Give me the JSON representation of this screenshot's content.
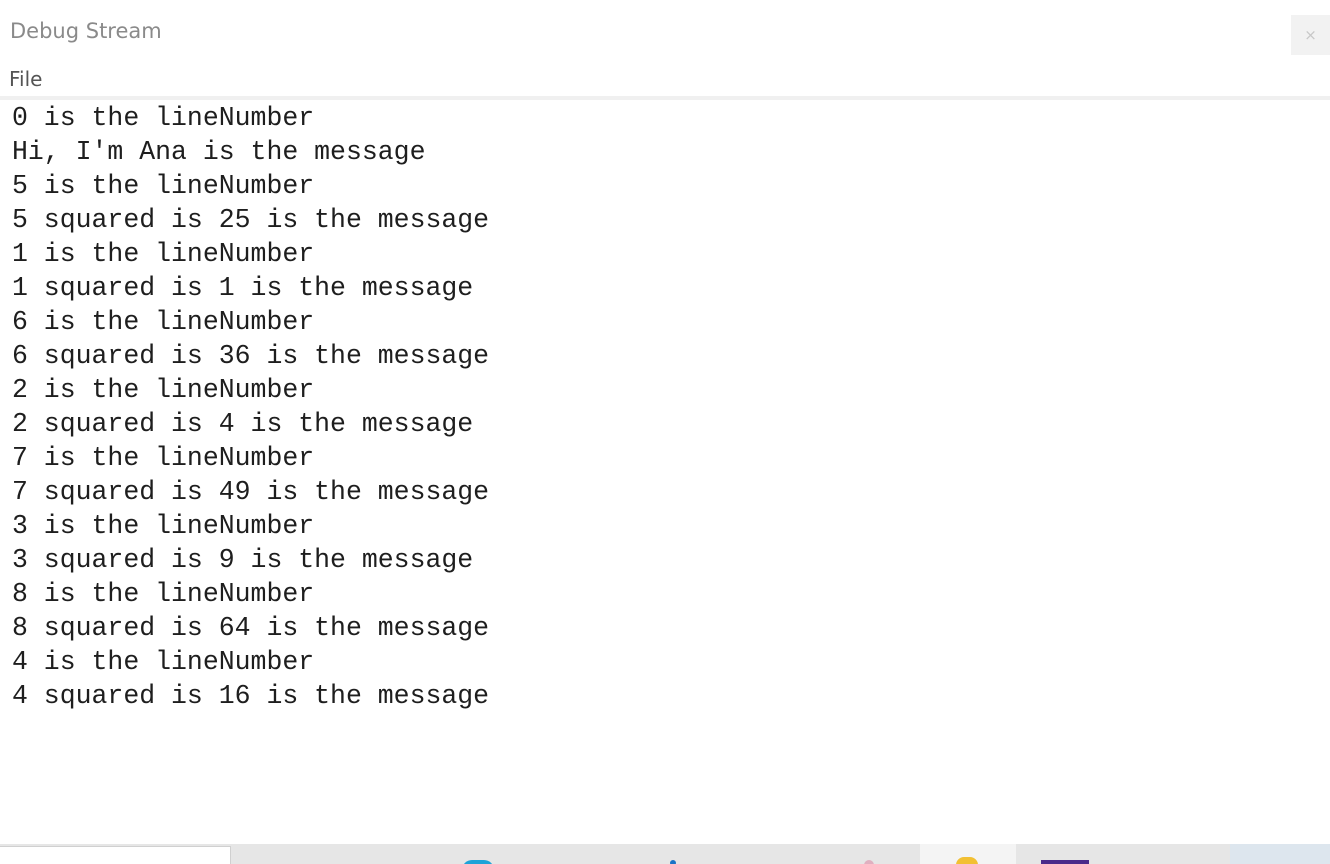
{
  "window": {
    "title": "Debug Stream",
    "close_glyph": "×"
  },
  "menu": {
    "items": [
      {
        "label": "File"
      }
    ]
  },
  "output": {
    "lines": [
      "0 is the lineNumber",
      "Hi, I'm Ana is the message",
      "5 is the lineNumber",
      "5 squared is 25 is the message",
      "1 is the lineNumber",
      "1 squared is 1 is the message",
      "6 is the lineNumber",
      "6 squared is 36 is the message",
      "2 is the lineNumber",
      "2 squared is 4 is the message",
      "7 is the lineNumber",
      "7 squared is 49 is the message",
      "3 is the lineNumber",
      "3 squared is 9 is the message",
      "8 is the lineNumber",
      "8 squared is 64 is the message",
      "4 is the lineNumber",
      "4 squared is 16 is the message"
    ]
  },
  "taskbar": {
    "icons": [
      "edge-icon",
      "taskbar-dot-icon",
      "pin-icon",
      "folder-icon",
      "app-icon"
    ]
  },
  "colors": {
    "title_text": "#8a8a8a",
    "menu_text": "#555555",
    "output_text": "#1e1e1e",
    "close_button_bg": "#f2f2f2",
    "taskbar_bg": "#e6e6e6"
  }
}
